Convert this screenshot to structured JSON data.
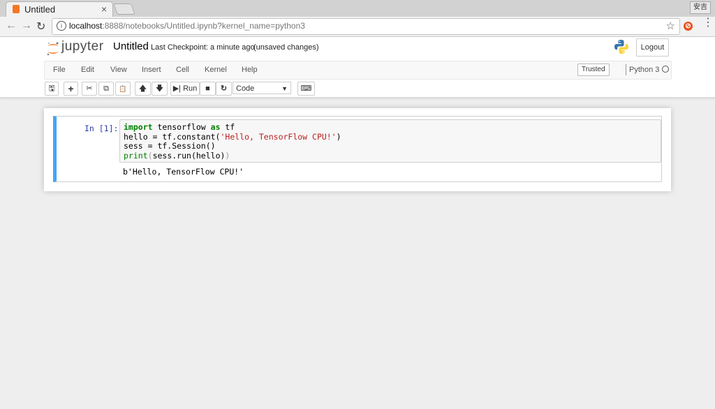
{
  "browser": {
    "tab_title": "Untitled",
    "tab_close": "×",
    "profile_label": "安吉",
    "url_host": "localhost",
    "url_path": ":8888/notebooks/Untitled.ipynb?kernel_name=python3",
    "back_icon": "←",
    "forward_icon": "→",
    "reload_icon": "↻",
    "info_icon": "i",
    "star_icon": "☆",
    "ext_icon": "⊘",
    "menu_icon": "⋮"
  },
  "jupyter": {
    "logo_text": "jupyter",
    "notebook_name": "Untitled",
    "checkpoint": "Last Checkpoint: a minute ago",
    "unsaved": "(unsaved changes)",
    "logout_label": "Logout",
    "menu": [
      "File",
      "Edit",
      "View",
      "Insert",
      "Cell",
      "Kernel",
      "Help"
    ],
    "trusted_label": "Trusted",
    "kernel_name": "Python 3",
    "toolbar": {
      "save_icon": "🖫",
      "add_icon": "+",
      "cut_icon": "✂",
      "copy_icon": "⧉",
      "paste_icon": "📋",
      "up_icon": "🡅",
      "down_icon": "🡇",
      "run_label": "▶| Run",
      "stop_icon": "■",
      "restart_icon": "↻",
      "cell_type": "Code",
      "cell_type_caret": "▼",
      "keyboard_icon": "⌨"
    }
  },
  "cell": {
    "prompt": "In [1]:",
    "code_lines": [
      [
        {
          "t": "import",
          "c": "kw"
        },
        {
          "t": " tensorflow ",
          "c": ""
        },
        {
          "t": "as",
          "c": "kw"
        },
        {
          "t": " tf",
          "c": ""
        }
      ],
      [
        {
          "t": "hello = tf.constant(",
          "c": ""
        },
        {
          "t": "'Hello, TensorFlow CPU!'",
          "c": "str"
        },
        {
          "t": ")",
          "c": ""
        }
      ],
      [
        {
          "t": "sess = tf.Session()",
          "c": ""
        }
      ],
      [
        {
          "t": "print",
          "c": "builtin"
        },
        {
          "t": "(",
          "c": "par"
        },
        {
          "t": "sess.run(hello)",
          "c": ""
        },
        {
          "t": ")",
          "c": "par"
        }
      ]
    ],
    "output": "b'Hello, TensorFlow CPU!'"
  }
}
